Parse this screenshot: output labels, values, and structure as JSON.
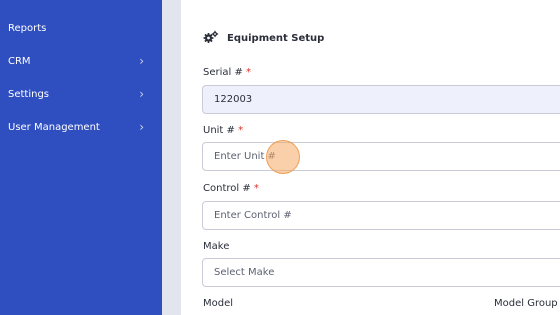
{
  "sidebar": {
    "items": [
      {
        "label": "Reports",
        "has_chevron": false
      },
      {
        "label": "CRM",
        "has_chevron": true
      },
      {
        "label": "Settings",
        "has_chevron": true
      },
      {
        "label": "User Management",
        "has_chevron": true
      }
    ],
    "chevron_glyph": "›"
  },
  "main": {
    "section_title": "Equipment Setup",
    "section_icon": "gears-icon",
    "required_mark": "*",
    "fields": {
      "serial": {
        "label": "Serial #",
        "value": "122003"
      },
      "unit": {
        "label": "Unit #",
        "placeholder": "Enter Unit #"
      },
      "control": {
        "label": "Control #",
        "placeholder": "Enter Control #"
      },
      "make": {
        "label": "Make",
        "placeholder": "Select Make"
      }
    },
    "model_label": "Model",
    "model_group_label": "Model Group"
  },
  "colors": {
    "sidebar_bg": "#2f4ec0",
    "required": "#d93025",
    "click_indicator": "#f5aa64"
  }
}
